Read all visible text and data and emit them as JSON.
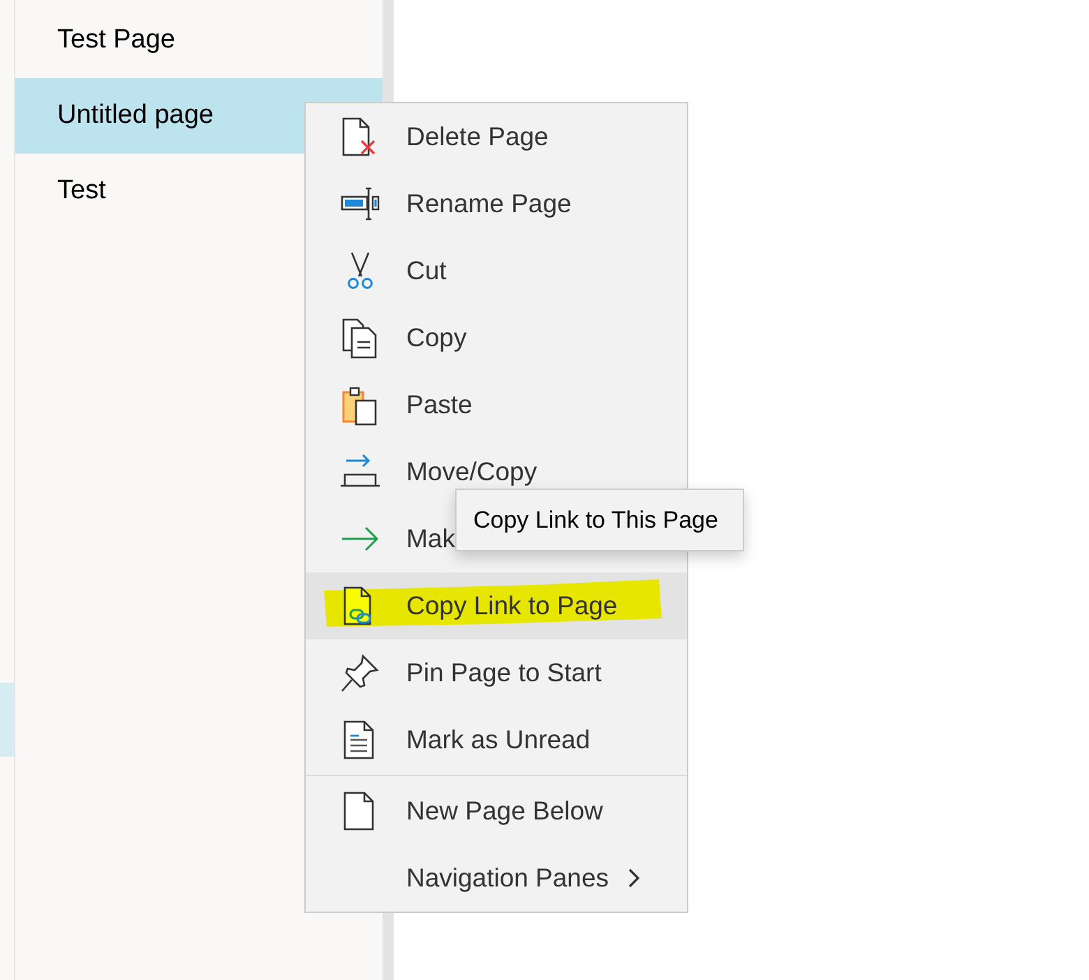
{
  "pages": [
    {
      "title": "Test Page",
      "selected": false
    },
    {
      "title": "Untitled page",
      "selected": true
    },
    {
      "title": "Test",
      "selected": false
    }
  ],
  "context_menu": {
    "items": [
      {
        "label": "Delete Page",
        "kind": "command",
        "hovered": false,
        "highlighted": false,
        "separator_before": false
      },
      {
        "label": "Rename Page",
        "kind": "command",
        "hovered": false,
        "highlighted": false,
        "separator_before": false
      },
      {
        "label": "Cut",
        "kind": "command",
        "hovered": false,
        "highlighted": false,
        "separator_before": false
      },
      {
        "label": "Copy",
        "kind": "command",
        "hovered": false,
        "highlighted": false,
        "separator_before": false
      },
      {
        "label": "Paste",
        "kind": "command",
        "hovered": false,
        "highlighted": false,
        "separator_before": false
      },
      {
        "label": "Move/Copy",
        "kind": "command",
        "hovered": false,
        "highlighted": false,
        "separator_before": false
      },
      {
        "label": "Mak",
        "kind": "command",
        "hovered": false,
        "highlighted": false,
        "separator_before": false
      },
      {
        "label": "Copy Link to Page",
        "kind": "command",
        "hovered": true,
        "highlighted": true,
        "separator_before": false
      },
      {
        "label": "Pin Page to Start",
        "kind": "command",
        "hovered": false,
        "highlighted": false,
        "separator_before": false
      },
      {
        "label": "Mark as Unread",
        "kind": "command",
        "hovered": false,
        "highlighted": false,
        "separator_before": false
      },
      {
        "label": "New Page Below",
        "kind": "command",
        "hovered": false,
        "highlighted": false,
        "separator_before": true
      },
      {
        "label": "Navigation Panes",
        "kind": "submenu",
        "hovered": false,
        "highlighted": false,
        "separator_before": false
      }
    ]
  },
  "tooltip": {
    "text": "Copy Link to This Page"
  }
}
